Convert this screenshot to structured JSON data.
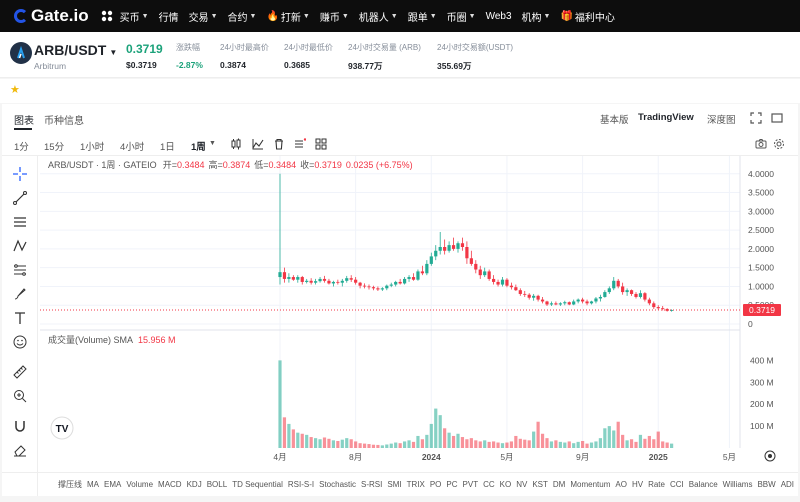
{
  "nav": {
    "logo": "Gate.io",
    "items": [
      {
        "label": "买币",
        "caret": true
      },
      {
        "label": "行情",
        "caret": false
      },
      {
        "label": "交易",
        "caret": true
      },
      {
        "label": "合约",
        "caret": true
      },
      {
        "label": "打新",
        "caret": true,
        "icon": "fire"
      },
      {
        "label": "赚币",
        "caret": true
      },
      {
        "label": "机器人",
        "caret": true
      },
      {
        "label": "跟单",
        "caret": true
      },
      {
        "label": "币圈",
        "caret": true
      },
      {
        "label": "Web3",
        "caret": false
      },
      {
        "label": "机构",
        "caret": true
      },
      {
        "label": "福利中心",
        "caret": false,
        "icon": "gift"
      }
    ]
  },
  "ticker": {
    "pair": "ARB/USDT",
    "name": "Arbitrum",
    "price": "0.3719",
    "price_usd": "$0.3719",
    "stats": [
      {
        "label": "涨跌幅",
        "value": "-2.87%",
        "color": "#1ba27a"
      },
      {
        "label": "24小时最高价",
        "value": "0.3874",
        "color": "#1f2329"
      },
      {
        "label": "24小时最低价",
        "value": "0.3685",
        "color": "#1f2329"
      },
      {
        "label": "24小时交易量 (ARB)",
        "value": "938.77万",
        "color": "#1f2329"
      },
      {
        "label": "24小时交易额(USDT)",
        "value": "355.69万",
        "color": "#1f2329"
      }
    ]
  },
  "panel": {
    "tabs": [
      "图表",
      "币种信息"
    ],
    "views": [
      "基本版",
      "TradingView",
      "深度图"
    ],
    "timeframes": [
      "1分",
      "15分",
      "1小时",
      "4小时",
      "1日",
      "1周"
    ],
    "active_timeframe": "1周"
  },
  "legend": {
    "title": "ARB/USDT · 1周 · GATEIO",
    "open_label": "开=",
    "open": "0.3484",
    "high_label": "高=",
    "high": "0.3874",
    "low_label": "低=",
    "low": "0.3484",
    "close_label": "收=",
    "close": "0.3719",
    "change": "0.0235 (+6.75%)"
  },
  "volume_legend": {
    "label": "成交量(Volume) SMA",
    "value": "15.956 M"
  },
  "price_label": "0.3719",
  "colors": {
    "up": "#22ab94",
    "down": "#f23645",
    "brand": "#2354e6"
  },
  "chart_data": {
    "type": "candlestick",
    "y_ticks": [
      "4.0000",
      "3.5000",
      "3.0000",
      "2.5000",
      "2.0000",
      "1.5000",
      "1.0000",
      "0.5000",
      "0"
    ],
    "y_tick_values": [
      4,
      3.5,
      3,
      2.5,
      2,
      1.5,
      1,
      0.5,
      0
    ],
    "ylim": [
      0,
      4.1
    ],
    "volume_ticks": [
      "400 M",
      "300 M",
      "200 M",
      "100 M"
    ],
    "volume_tick_values": [
      400,
      300,
      200,
      100
    ],
    "x_ticks": [
      "4月",
      "8月",
      "2024",
      "5月",
      "9月",
      "2025",
      "5月",
      "9月"
    ],
    "x_tick_index": [
      0,
      17,
      34,
      51,
      68,
      85,
      101,
      118
    ],
    "candles": [
      [
        1.25,
        4.0,
        1.05,
        1.38
      ],
      [
        1.38,
        1.5,
        1.1,
        1.2
      ],
      [
        1.2,
        1.35,
        1.1,
        1.25
      ],
      [
        1.25,
        1.3,
        1.15,
        1.18
      ],
      [
        1.18,
        1.3,
        1.1,
        1.25
      ],
      [
        1.25,
        1.28,
        1.05,
        1.12
      ],
      [
        1.12,
        1.2,
        1.08,
        1.15
      ],
      [
        1.15,
        1.22,
        1.05,
        1.1
      ],
      [
        1.1,
        1.2,
        1.05,
        1.14
      ],
      [
        1.14,
        1.25,
        1.1,
        1.2
      ],
      [
        1.2,
        1.28,
        1.1,
        1.15
      ],
      [
        1.15,
        1.2,
        1.05,
        1.08
      ],
      [
        1.08,
        1.15,
        1.0,
        1.12
      ],
      [
        1.12,
        1.18,
        1.05,
        1.1
      ],
      [
        1.1,
        1.2,
        1.0,
        1.15
      ],
      [
        1.15,
        1.28,
        1.1,
        1.22
      ],
      [
        1.22,
        1.3,
        1.12,
        1.18
      ],
      [
        1.18,
        1.25,
        1.05,
        1.1
      ],
      [
        1.1,
        1.12,
        0.95,
        1.02
      ],
      [
        1.02,
        1.08,
        0.95,
        1.0
      ],
      [
        1.0,
        1.05,
        0.92,
        0.98
      ],
      [
        0.98,
        1.02,
        0.9,
        0.95
      ],
      [
        0.95,
        1.0,
        0.88,
        0.92
      ],
      [
        0.92,
        0.98,
        0.88,
        0.95
      ],
      [
        0.95,
        1.05,
        0.9,
        1.02
      ],
      [
        1.02,
        1.1,
        0.98,
        1.05
      ],
      [
        1.05,
        1.15,
        1.0,
        1.12
      ],
      [
        1.12,
        1.2,
        1.05,
        1.08
      ],
      [
        1.08,
        1.25,
        1.05,
        1.2
      ],
      [
        1.2,
        1.3,
        1.12,
        1.25
      ],
      [
        1.25,
        1.35,
        1.15,
        1.18
      ],
      [
        1.18,
        1.45,
        1.15,
        1.4
      ],
      [
        1.4,
        1.55,
        1.3,
        1.35
      ],
      [
        1.35,
        1.7,
        1.3,
        1.6
      ],
      [
        1.6,
        1.9,
        1.55,
        1.8
      ],
      [
        1.8,
        2.1,
        1.7,
        1.95
      ],
      [
        1.95,
        2.45,
        1.85,
        2.05
      ],
      [
        2.05,
        2.25,
        1.85,
        1.95
      ],
      [
        1.95,
        2.2,
        1.9,
        2.1
      ],
      [
        2.1,
        2.3,
        1.95,
        2.0
      ],
      [
        2.0,
        2.2,
        1.9,
        2.15
      ],
      [
        2.15,
        2.3,
        1.95,
        2.05
      ],
      [
        2.05,
        2.2,
        1.6,
        1.75
      ],
      [
        1.75,
        1.95,
        1.55,
        1.6
      ],
      [
        1.6,
        1.7,
        1.35,
        1.45
      ],
      [
        1.45,
        1.55,
        1.2,
        1.3
      ],
      [
        1.3,
        1.5,
        1.25,
        1.4
      ],
      [
        1.4,
        1.45,
        1.15,
        1.2
      ],
      [
        1.2,
        1.3,
        1.05,
        1.12
      ],
      [
        1.12,
        1.18,
        1.0,
        1.05
      ],
      [
        1.05,
        1.25,
        1.0,
        1.18
      ],
      [
        1.18,
        1.22,
        0.98,
        1.02
      ],
      [
        1.02,
        1.1,
        0.92,
        0.98
      ],
      [
        0.98,
        1.05,
        0.88,
        0.9
      ],
      [
        0.9,
        0.95,
        0.75,
        0.8
      ],
      [
        0.8,
        0.88,
        0.72,
        0.78
      ],
      [
        0.78,
        0.82,
        0.65,
        0.7
      ],
      [
        0.7,
        0.8,
        0.62,
        0.75
      ],
      [
        0.75,
        0.78,
        0.6,
        0.65
      ],
      [
        0.65,
        0.72,
        0.55,
        0.6
      ],
      [
        0.6,
        0.62,
        0.48,
        0.52
      ],
      [
        0.52,
        0.6,
        0.48,
        0.55
      ],
      [
        0.55,
        0.6,
        0.5,
        0.52
      ],
      [
        0.52,
        0.58,
        0.48,
        0.55
      ],
      [
        0.55,
        0.62,
        0.5,
        0.58
      ],
      [
        0.58,
        0.6,
        0.5,
        0.52
      ],
      [
        0.52,
        0.65,
        0.5,
        0.6
      ],
      [
        0.6,
        0.68,
        0.55,
        0.65
      ],
      [
        0.65,
        0.7,
        0.55,
        0.6
      ],
      [
        0.6,
        0.65,
        0.5,
        0.55
      ],
      [
        0.55,
        0.62,
        0.52,
        0.6
      ],
      [
        0.6,
        0.72,
        0.55,
        0.68
      ],
      [
        0.68,
        0.78,
        0.6,
        0.72
      ],
      [
        0.72,
        0.9,
        0.7,
        0.85
      ],
      [
        0.85,
        1.0,
        0.8,
        0.95
      ],
      [
        0.95,
        1.25,
        0.9,
        1.15
      ],
      [
        1.15,
        1.2,
        0.95,
        1.0
      ],
      [
        1.0,
        1.1,
        0.78,
        0.85
      ],
      [
        0.85,
        0.95,
        0.75,
        0.9
      ],
      [
        0.9,
        0.92,
        0.75,
        0.8
      ],
      [
        0.8,
        0.85,
        0.68,
        0.72
      ],
      [
        0.72,
        0.9,
        0.68,
        0.82
      ],
      [
        0.82,
        0.85,
        0.6,
        0.65
      ],
      [
        0.65,
        0.7,
        0.5,
        0.55
      ],
      [
        0.55,
        0.6,
        0.4,
        0.45
      ],
      [
        0.45,
        0.5,
        0.38,
        0.42
      ],
      [
        0.42,
        0.48,
        0.36,
        0.4
      ],
      [
        0.4,
        0.42,
        0.33,
        0.35
      ],
      [
        0.35,
        0.39,
        0.33,
        0.37
      ]
    ],
    "volumes": [
      400,
      140,
      110,
      85,
      70,
      65,
      60,
      50,
      45,
      40,
      48,
      42,
      35,
      32,
      38,
      45,
      40,
      30,
      22,
      20,
      18,
      15,
      14,
      12,
      16,
      20,
      25,
      22,
      30,
      35,
      28,
      55,
      40,
      60,
      110,
      180,
      150,
      90,
      70,
      55,
      65,
      50,
      40,
      45,
      35,
      30,
      35,
      28,
      30,
      25,
      22,
      25,
      30,
      55,
      42,
      38,
      35,
      75,
      120,
      65,
      45,
      30,
      35,
      28,
      25,
      30,
      22,
      28,
      32,
      20,
      25,
      30,
      45,
      90,
      100,
      80,
      120,
      60,
      35,
      40,
      28,
      60,
      42,
      55,
      40,
      75,
      30,
      25,
      20
    ]
  }
}
